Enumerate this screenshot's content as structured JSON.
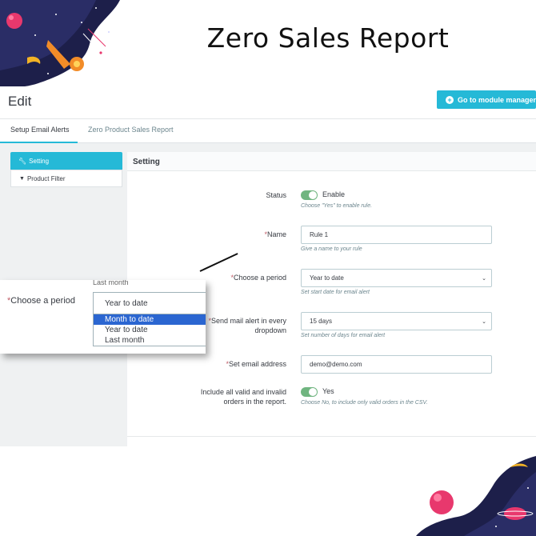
{
  "page": {
    "title": "Zero Sales Report"
  },
  "header": {
    "edit_title": "Edit",
    "module_button": "Go to module manager"
  },
  "tabs": [
    {
      "label": "Setup Email Alerts",
      "active": true
    },
    {
      "label": "Zero Product Sales Report",
      "active": false
    }
  ],
  "sidebar": {
    "items": [
      {
        "label": "Setting"
      },
      {
        "label": "Product Filter"
      }
    ]
  },
  "panel": {
    "title": "Setting",
    "status": {
      "label": "Status",
      "value": "Enable",
      "hint": "Choose \"Yes\" to enable rule."
    },
    "name": {
      "label": "Name",
      "value": "Rule 1",
      "hint": "Give a name to your rule"
    },
    "period": {
      "label": "Choose a period",
      "value": "Year to date",
      "hint": "Set start date for email alert"
    },
    "send_alert": {
      "label_line1": "Send mail alert in every",
      "label_line2": "dropdown",
      "value": "15 days",
      "hint": "Set number of days for email alert"
    },
    "email": {
      "label": "Set email address",
      "value": "demo@demo.com"
    },
    "include_orders": {
      "label_line1": "Include all valid and invalid",
      "label_line2": "orders in the report.",
      "value": "Yes",
      "hint": "Choose No, to include only valid orders in the CSV."
    }
  },
  "zoom": {
    "label": "Choose a period",
    "cut_text": "Last month",
    "selected": "Year to date",
    "options": [
      "Month to date",
      "Year to date",
      "Last month"
    ]
  },
  "colors": {
    "accent": "#25b9d7",
    "toggle": "#70b580",
    "required": "#c05c67",
    "highlight": "#2b66d1"
  }
}
